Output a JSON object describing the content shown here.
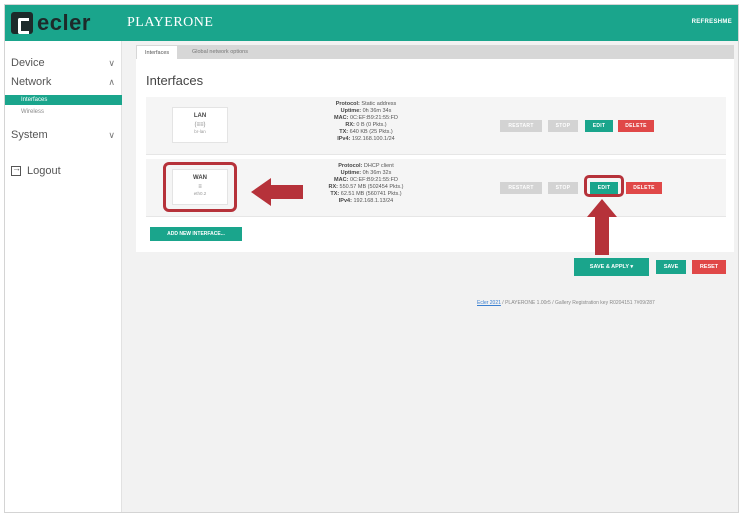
{
  "header": {
    "logo_text": "ecler",
    "device_name": "PLAYERONE",
    "refresh_label": "REFRESHME"
  },
  "sidebar": {
    "items": [
      {
        "label": "Device"
      },
      {
        "label": "Network",
        "sub": [
          {
            "label": "Interfaces"
          },
          {
            "label": "Wireless"
          }
        ]
      },
      {
        "label": "System"
      }
    ],
    "logout_label": "Logout"
  },
  "tabs": [
    {
      "label": "Interfaces"
    },
    {
      "label": "Global network options"
    }
  ],
  "main": {
    "title": "Interfaces",
    "interfaces": [
      {
        "name": "LAN",
        "icon_text": "(≡≡)",
        "device": "br-lan",
        "lines": [
          {
            "k": "Protocol:",
            "v": "Static address"
          },
          {
            "k": "Uptime:",
            "v": "0h 36m 34s"
          },
          {
            "k": "MAC:",
            "v": "0C:EF:B9:21:55:FD"
          },
          {
            "k": "RX:",
            "v": "0 B (0 Pkts.)"
          },
          {
            "k": "TX:",
            "v": "640 KB (25 Pkts.)"
          },
          {
            "k": "IPv4:",
            "v": "192.168.100.1/24"
          }
        ]
      },
      {
        "name": "WAN",
        "icon_text": "≡",
        "device": "eth0.2",
        "lines": [
          {
            "k": "Protocol:",
            "v": "DHCP client"
          },
          {
            "k": "Uptime:",
            "v": "0h 36m 32s"
          },
          {
            "k": "MAC:",
            "v": "0C:EF:B9:21:55:FD"
          },
          {
            "k": "RX:",
            "v": "550.57 MB (502454 Pkts.)"
          },
          {
            "k": "TX:",
            "v": "62.51 MB (560741 Pkts.)"
          },
          {
            "k": "IPv4:",
            "v": "192.168.1.13/24"
          }
        ]
      }
    ],
    "row_buttons": {
      "restart": "RESTART",
      "stop": "STOP",
      "edit": "EDIT",
      "delete": "DELETE"
    },
    "add_interface_label": "ADD NEW INTERFACE..."
  },
  "actions": {
    "save_apply": "SAVE & APPLY ▾",
    "save": "SAVE",
    "reset": "RESET"
  },
  "footer": {
    "link_text": "Ecler 2021",
    "rest": " / PLAYERONE 1.00r5 / Gallery Registration key R0204151 7#09/287"
  },
  "colors": {
    "accent": "#1aa58c",
    "danger": "#e04848",
    "annotation": "#b6323a"
  }
}
